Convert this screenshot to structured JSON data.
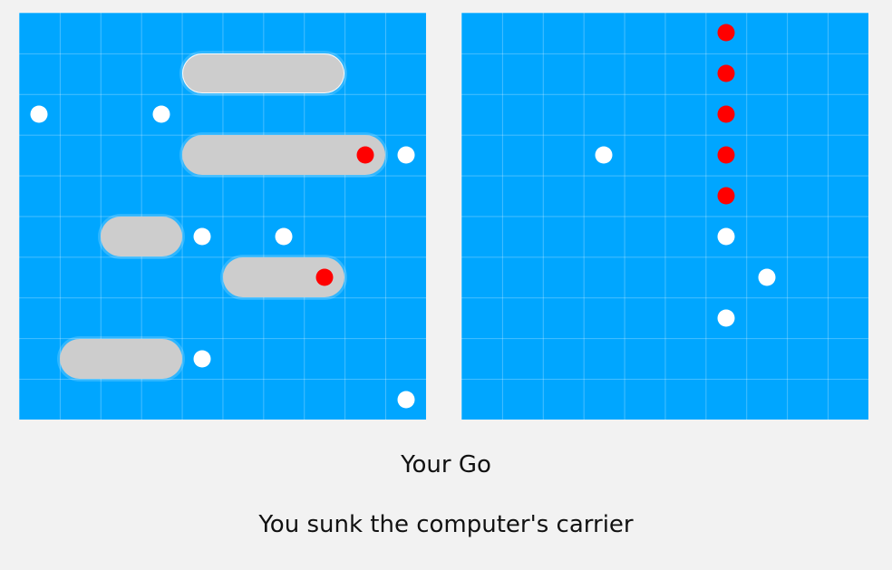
{
  "grid_size": 10,
  "colors": {
    "water": "#00a6ff",
    "ship": "#cdcdcd",
    "hit": "#ff0000",
    "miss": "#ffffff",
    "background": "#f2f2f2"
  },
  "player_board": {
    "ships": [
      {
        "row": 1,
        "col": 4,
        "length": 4,
        "selected": true
      },
      {
        "row": 3,
        "col": 4,
        "length": 5,
        "selected": false
      },
      {
        "row": 5,
        "col": 2,
        "length": 2,
        "selected": false
      },
      {
        "row": 6,
        "col": 5,
        "length": 3,
        "selected": false
      },
      {
        "row": 8,
        "col": 1,
        "length": 3,
        "selected": false
      }
    ],
    "shots": [
      {
        "row": 2,
        "col": 0,
        "result": "miss"
      },
      {
        "row": 2,
        "col": 3,
        "result": "miss"
      },
      {
        "row": 3,
        "col": 8,
        "result": "hit"
      },
      {
        "row": 3,
        "col": 9,
        "result": "miss"
      },
      {
        "row": 5,
        "col": 4,
        "result": "miss"
      },
      {
        "row": 5,
        "col": 6,
        "result": "miss"
      },
      {
        "row": 6,
        "col": 7,
        "result": "hit"
      },
      {
        "row": 8,
        "col": 4,
        "result": "miss"
      },
      {
        "row": 9,
        "col": 9,
        "result": "miss"
      }
    ]
  },
  "computer_board": {
    "shots": [
      {
        "row": 0,
        "col": 6,
        "result": "hit"
      },
      {
        "row": 1,
        "col": 6,
        "result": "hit"
      },
      {
        "row": 2,
        "col": 6,
        "result": "hit"
      },
      {
        "row": 3,
        "col": 3,
        "result": "miss"
      },
      {
        "row": 3,
        "col": 6,
        "result": "hit"
      },
      {
        "row": 4,
        "col": 6,
        "result": "hit"
      },
      {
        "row": 5,
        "col": 6,
        "result": "miss"
      },
      {
        "row": 6,
        "col": 7,
        "result": "miss"
      },
      {
        "row": 7,
        "col": 6,
        "result": "miss"
      }
    ]
  },
  "status": {
    "turn": "Your Go",
    "message": "You sunk the computer's carrier"
  }
}
